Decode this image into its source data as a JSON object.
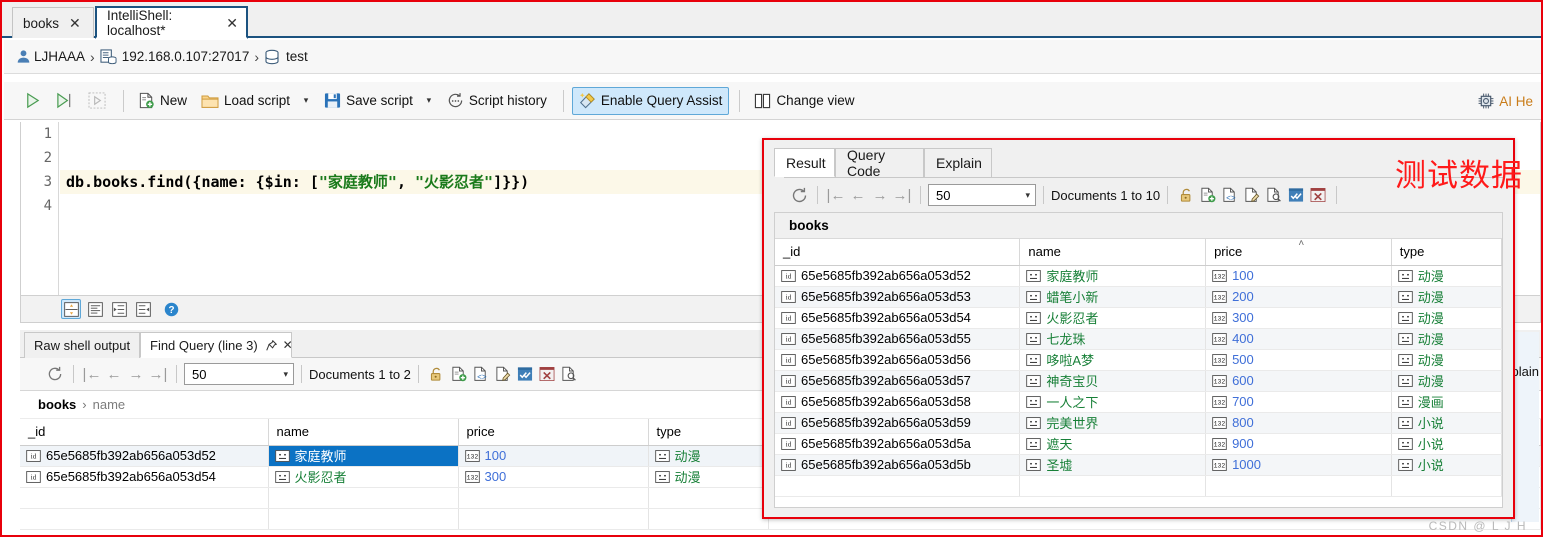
{
  "window": {
    "tabs": [
      {
        "label": "books",
        "active": false,
        "close": "✕"
      },
      {
        "label": "IntelliShell: localhost*",
        "active": true,
        "close": "✕"
      }
    ]
  },
  "breadcrumb": {
    "user": "LJHAAA",
    "server": "192.168.0.107:27017",
    "database": "test",
    "sep": "›"
  },
  "toolbar": {
    "run_label": "",
    "new_label": "New",
    "load_script_label": "Load script",
    "save_script_label": "Save script",
    "script_history_label": "Script history",
    "query_assist_label": "Enable Query Assist",
    "change_view_label": "Change view",
    "ai_helper_label": "AI He",
    "caret": "▾"
  },
  "editor": {
    "line_numbers": [
      "1",
      "2",
      "3",
      "4"
    ],
    "active_line_index": 2,
    "code_prefix": "db.books.find({name: {$in: [",
    "code_str1": "\"家庭教师\"",
    "code_comma": ", ",
    "code_str2": "\"火影忍者\"",
    "code_suffix": "]}})"
  },
  "editor_bottom": {
    "buttons": [
      "format-icon",
      "align-icon",
      "indent-right-icon",
      "indent-left-icon",
      "help-icon"
    ]
  },
  "bottom_panel": {
    "tabs": [
      {
        "label": "Raw shell output",
        "active": false
      },
      {
        "label": "Find Query (line 3)",
        "active": true,
        "pin": "⚖",
        "close": "✕"
      }
    ],
    "page_size": "50",
    "documents_label": "Documents 1 to 2",
    "breadcrumb": {
      "collection": "books",
      "field": "name",
      "sep": "›"
    },
    "columns": [
      "_id",
      "name",
      "price",
      "type"
    ],
    "rows": [
      {
        "_id": "65e5685fb392ab656a053d52",
        "name": "家庭教师",
        "price": "100",
        "type": "动漫",
        "selected": true
      },
      {
        "_id": "65e5685fb392ab656a053d54",
        "name": "火影忍者",
        "price": "300",
        "type": "动漫",
        "selected": false
      }
    ]
  },
  "result_panel": {
    "tabs": [
      {
        "label": "Result",
        "active": true
      },
      {
        "label": "Query Code",
        "active": false
      },
      {
        "label": "Explain",
        "active": false
      }
    ],
    "page_size": "50",
    "documents_label": "Documents 1 to 10",
    "collection_title": "books",
    "columns": [
      "_id",
      "name",
      "price",
      "type"
    ],
    "sorted_column": "price",
    "sort_caret": "˄",
    "rows": [
      {
        "_id": "65e5685fb392ab656a053d52",
        "name": "家庭教师",
        "price": "100",
        "type": "动漫"
      },
      {
        "_id": "65e5685fb392ab656a053d53",
        "name": "蜡笔小新",
        "price": "200",
        "type": "动漫"
      },
      {
        "_id": "65e5685fb392ab656a053d54",
        "name": "火影忍者",
        "price": "300",
        "type": "动漫"
      },
      {
        "_id": "65e5685fb392ab656a053d55",
        "name": "七龙珠",
        "price": "400",
        "type": "动漫"
      },
      {
        "_id": "65e5685fb392ab656a053d56",
        "name": "哆啦A梦",
        "price": "500",
        "type": "动漫"
      },
      {
        "_id": "65e5685fb392ab656a053d57",
        "name": "神奇宝贝",
        "price": "600",
        "type": "动漫"
      },
      {
        "_id": "65e5685fb392ab656a053d58",
        "name": "一人之下",
        "price": "700",
        "type": "漫画"
      },
      {
        "_id": "65e5685fb392ab656a053d59",
        "name": "完美世界",
        "price": "800",
        "type": "小说"
      },
      {
        "_id": "65e5685fb392ab656a053d5a",
        "name": "遮天",
        "price": "900",
        "type": "小说"
      },
      {
        "_id": "65e5685fb392ab656a053d5b",
        "name": "圣墟",
        "price": "1000",
        "type": "小说"
      }
    ]
  },
  "annotation": {
    "text": "测试数据",
    "color": "#ff1a1a"
  },
  "ghost_tab": {
    "label": "xplain"
  },
  "watermark": {
    "text": "CSDN @ L J H"
  },
  "nav_icons": {
    "first": "|←",
    "prev": "←",
    "next": "→",
    "last": "→|",
    "refresh": "⟳"
  }
}
